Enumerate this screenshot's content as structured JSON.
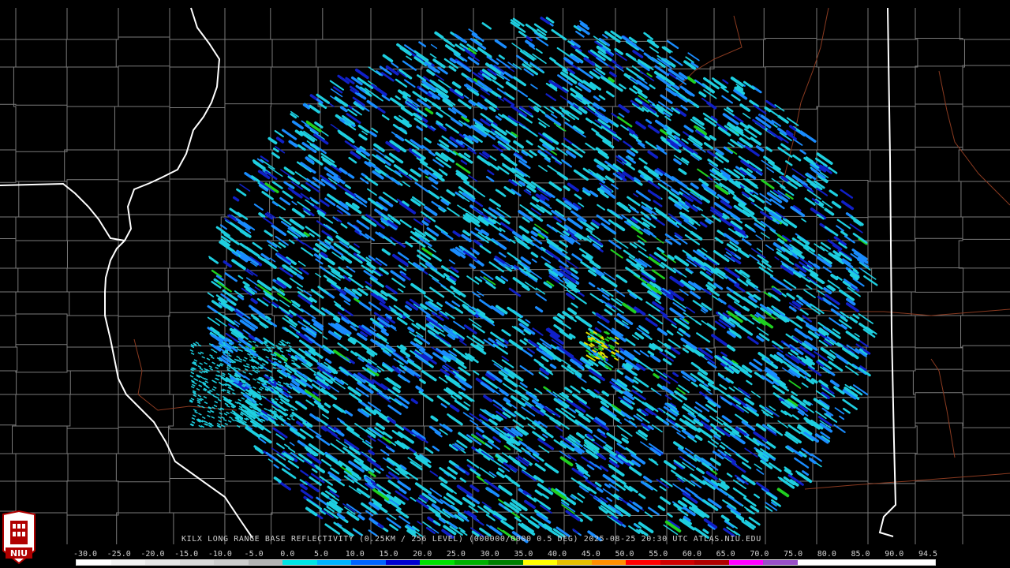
{
  "map": {
    "radar_site": "KILX",
    "logo_text": "NIU"
  },
  "caption": "KILX LONG RANGE BASE REFLECTIVITY (0.25KM / 256 LEVEL) (000000/0000 0.5 DEG) 2025-08-25 20:30 UTC  ATLAS.NIU.EDU",
  "legend": {
    "labels": [
      "-30.0",
      "-25.0",
      "-20.0",
      "-15.0",
      "-10.0",
      "-5.0",
      "0.0",
      "5.0",
      "10.0",
      "15.0",
      "20.0",
      "25.0",
      "30.0",
      "35.0",
      "40.0",
      "45.0",
      "50.0",
      "55.0",
      "60.0",
      "65.0",
      "70.0",
      "75.0",
      "80.0",
      "85.0",
      "90.0",
      "94.5"
    ],
    "colors": [
      "#ffffff",
      "#f2f2f2",
      "#e6e6e6",
      "#d9d9d9",
      "#cccccc",
      "#b3b3b3",
      "#00e5e5",
      "#00b4ff",
      "#0064ff",
      "#0000d0",
      "#00e000",
      "#00b000",
      "#008000",
      "#ffff00",
      "#e6c000",
      "#ff9000",
      "#ff0000",
      "#d00000",
      "#b00000",
      "#ff00ff",
      "#9a50c8",
      "#ffffff",
      "#ffffff",
      "#ffffff",
      "#ffffff"
    ]
  },
  "colors": {
    "background": "#000000",
    "county_lines": "#7a7a7a",
    "state_lines": "#ffffff",
    "rivers_roads": "#8a3a20",
    "echo_light": "#1ecfe0",
    "echo_mid": "#1a8cff",
    "echo_dark": "#1020c8",
    "echo_green": "#20d020",
    "echo_yellow": "#e0e000"
  }
}
